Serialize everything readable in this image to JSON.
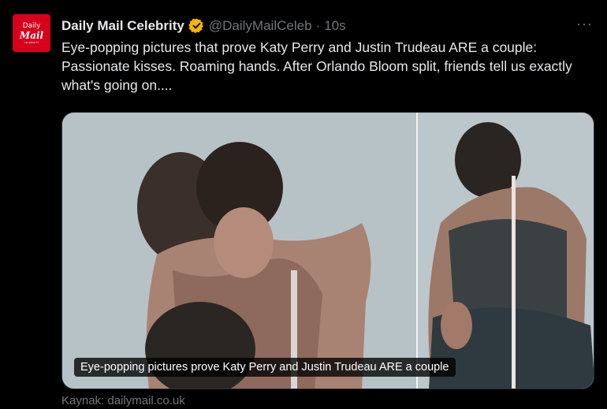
{
  "account": {
    "avatar_lines": [
      "Daily",
      "Mail",
      "CELEBRITY"
    ],
    "name": "Daily Mail Celebrity",
    "handle": "@DailyMailCeleb",
    "separator": "·",
    "time": "10s",
    "verified_badge_icon": "verified-badge-icon",
    "badge_color": "#f4b400"
  },
  "menu": {
    "more_label": "···"
  },
  "tweet": {
    "text": "Eye-popping pictures that prove Katy Perry and Justin Trudeau ARE a couple: Passionate kisses. Roaming hands. After Orlando Bloom split, friends tell us exactly what's going on...."
  },
  "media": {
    "caption": "Eye-popping pictures prove Katy Perry and Justin Trudeau ARE a couple",
    "source": "Kaynak: dailymail.co.uk"
  },
  "colors": {
    "background": "#000000",
    "text_primary": "#e7e9ea",
    "text_secondary": "#71767b",
    "brand_red": "#d6001c"
  }
}
